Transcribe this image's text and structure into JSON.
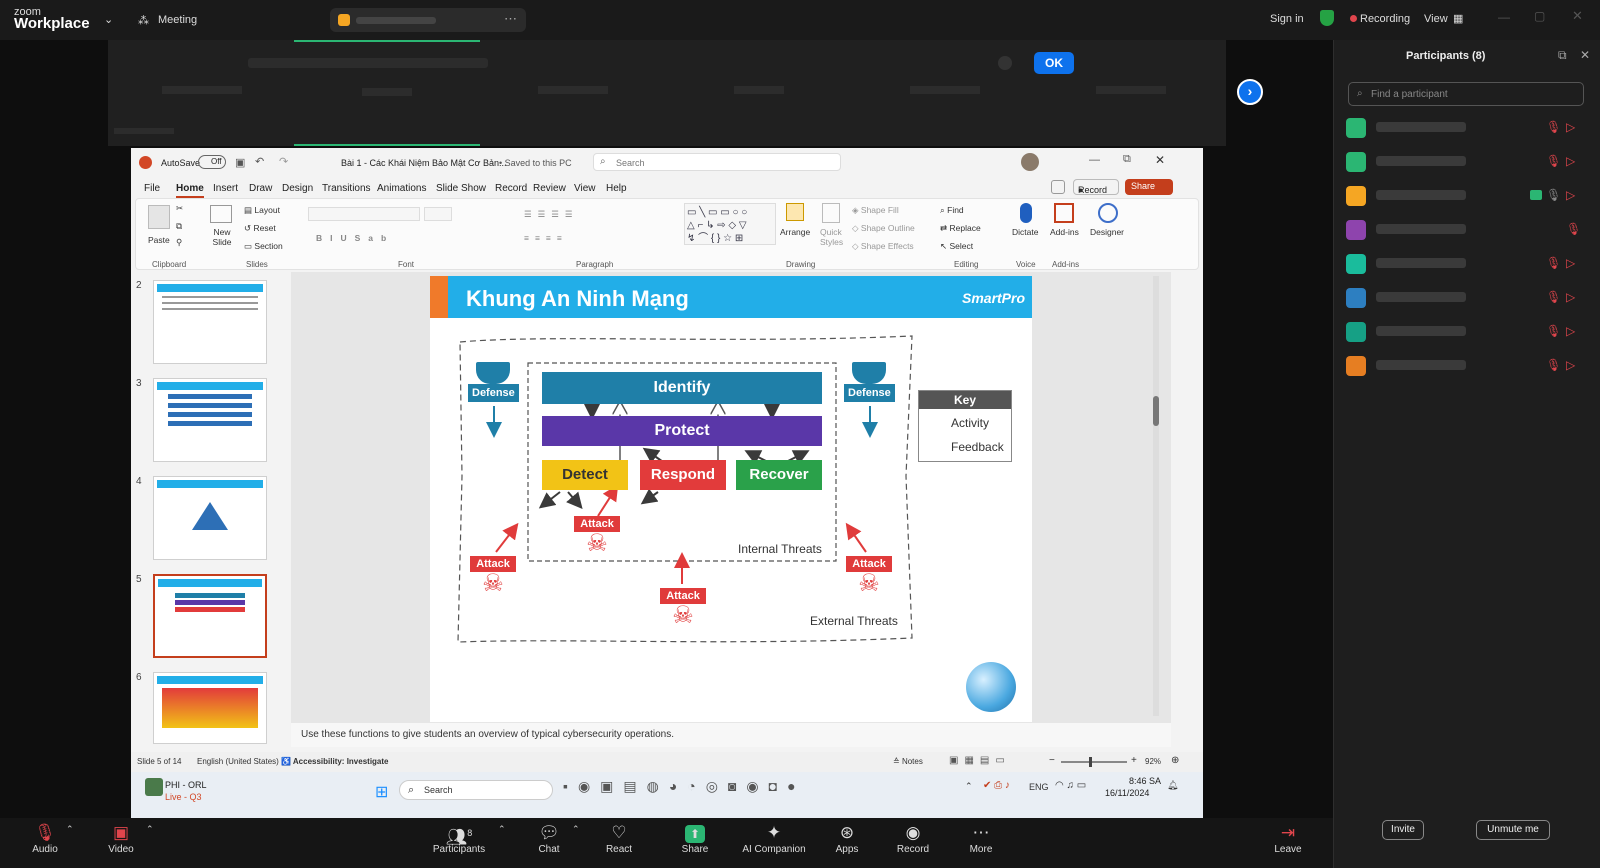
{
  "zoom": {
    "brand_top": "zoom",
    "brand_bottom": "Workplace",
    "meeting_label": "Meeting",
    "sign_in": "Sign in",
    "recording": "Recording",
    "view": "View",
    "ok": "OK"
  },
  "participants": {
    "title": "Participants (8)",
    "search_placeholder": "Find a participant",
    "avatar_colors": [
      "#2bb673",
      "#2bb673",
      "#f5a623",
      "#8e44ad",
      "#1abc9c",
      "#2d7fc1",
      "#16a085",
      "#e67e22"
    ],
    "invite": "Invite",
    "unmute_me": "Unmute me"
  },
  "bottom_bar": {
    "audio": "Audio",
    "video": "Video",
    "participants": "Participants",
    "participants_count": "8",
    "chat": "Chat",
    "react": "React",
    "share": "Share",
    "ai": "AI Companion",
    "apps": "Apps",
    "record": "Record",
    "more": "More",
    "leave": "Leave"
  },
  "ppt": {
    "autosave": "AutoSave",
    "autosave_state": "Off",
    "filename": "Bài 1 - Các Khái Niệm Bảo Mật Cơ Bản...",
    "saved": "• Saved to this PC",
    "search": "Search",
    "record_btn": "Record",
    "share_btn": "Share",
    "tabs": [
      "File",
      "Home",
      "Insert",
      "Draw",
      "Design",
      "Transitions",
      "Animations",
      "Slide Show",
      "Record",
      "Review",
      "View",
      "Help"
    ],
    "ribbon": {
      "paste": "Paste",
      "new_slide": "New Slide",
      "layout": "Layout",
      "reset": "Reset",
      "section": "Section",
      "arrange": "Arrange",
      "quick_styles": "Quick Styles",
      "shape_fill": "Shape Fill",
      "shape_outline": "Shape Outline",
      "shape_effects": "Shape Effects",
      "find": "Find",
      "replace": "Replace",
      "select": "Select",
      "dictate": "Dictate",
      "addins": "Add-ins",
      "designer": "Designer",
      "groups": {
        "clipboard": "Clipboard",
        "slides": "Slides",
        "font": "Font",
        "paragraph": "Paragraph",
        "drawing": "Drawing",
        "editing": "Editing",
        "voice": "Voice",
        "addins": "Add-ins"
      }
    },
    "thumb_numbers": [
      "2",
      "3",
      "4",
      "5",
      "6"
    ],
    "notes": "Use these functions to give students an overview of typical cybersecurity operations.",
    "status": {
      "slide": "Slide 5 of 14",
      "lang": "English (United States)",
      "accessibility": "Accessibility: Investigate",
      "notes_btn": "Notes",
      "zoom": "92%"
    },
    "taskbar": {
      "user_line1": "PHI - ORL",
      "user_line2": "Live - Q3",
      "search": "Search",
      "eng": "ENG",
      "time": "8:46 SA",
      "date": "16/11/2024"
    }
  },
  "slide": {
    "title": "Khung An Ninh Mạng",
    "logo": "SmartPro",
    "identify": "Identify",
    "protect": "Protect",
    "detect": "Detect",
    "respond": "Respond",
    "recover": "Recover",
    "defense": "Defense",
    "attack": "Attack",
    "key_title": "Key",
    "activity": "Activity",
    "feedback": "Feedback",
    "internal": "Internal Threats",
    "external": "External Threats",
    "colors": {
      "identify": "#1f7fa8",
      "protect": "#5a37a8",
      "detect": "#f2c316",
      "respond": "#e23b3b",
      "recover": "#2aa14a",
      "header": "#22aee8",
      "accent": "#f07a2a"
    }
  }
}
